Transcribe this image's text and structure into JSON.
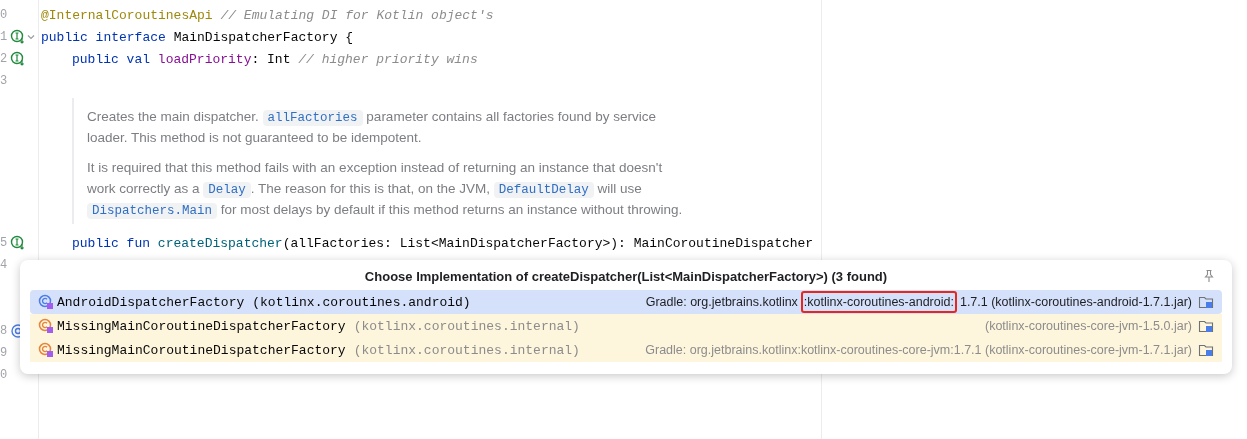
{
  "editor": {
    "lines": [
      {
        "kind": "code",
        "number": "0",
        "tokens": [
          {
            "kind": "annotation",
            "text": "@InternalCoroutinesApi"
          },
          {
            "kind": "comment",
            "text": " // Emulating DI for Kotlin object's"
          }
        ]
      },
      {
        "kind": "code",
        "number": "1",
        "gutter_icon": {
          "kind": "implemented"
        },
        "foldable": true,
        "tokens": [
          {
            "kind": "keyword",
            "text": "public interface"
          },
          {
            "kind": "plain",
            "text": " MainDispatcherFactory {"
          }
        ],
        "children": [
          {
            "kind": "code",
            "number": "2",
            "gutter_icon": {
              "kind": "implemented"
            },
            "tokens": [
              {
                "kind": "keyword",
                "text": "public val "
              },
              {
                "kind": "property",
                "text": "loadPriority"
              },
              {
                "kind": "plain",
                "text": ": Int "
              },
              {
                "kind": "comment",
                "text": "// higher priority wins"
              }
            ]
          },
          {
            "kind": "code",
            "number": "3"
          },
          {
            "kind": "doc",
            "paragraphs": [
              [
                {
                  "kind": "text",
                  "text": "Creates the main dispatcher. "
                },
                {
                  "kind": "code",
                  "text": "allFactories"
                },
                {
                  "kind": "text",
                  "text": " parameter contains all factories found by service loader. This method is not guaranteed to be idempotent."
                }
              ],
              [
                {
                  "kind": "text",
                  "text": "It is required that this method fails with an exception instead of returning an instance that doesn't work correctly as a "
                },
                {
                  "kind": "code",
                  "text": "Delay"
                },
                {
                  "kind": "text",
                  "text": ". The reason for this is that, on the JVM, "
                },
                {
                  "kind": "code",
                  "text": "DefaultDelay"
                },
                {
                  "kind": "text",
                  "text": " will use "
                },
                {
                  "kind": "code",
                  "text": "Dispatchers.Main"
                },
                {
                  "kind": "text",
                  "text": " for most delays by default if this method returns an instance without throwing."
                }
              ]
            ]
          },
          {
            "kind": "code",
            "number": "5",
            "gutter_icon": {
              "kind": "implemented"
            },
            "tokens": [
              {
                "kind": "keyword",
                "text": "public fun "
              },
              {
                "kind": "function",
                "text": "createDispatcher"
              },
              {
                "kind": "plain",
                "text": "(allFactories: List<MainDispatcherFactory>): MainCoroutineDispatcher"
              }
            ]
          }
        ]
      },
      {
        "kind": "code",
        "number": "4"
      },
      {
        "kind": "code"
      },
      {
        "kind": "code"
      },
      {
        "kind": "code",
        "number": "8",
        "gutter_icon": {
          "kind": "overrides"
        }
      },
      {
        "kind": "code",
        "number": "9"
      },
      {
        "kind": "code",
        "number": "0"
      }
    ]
  },
  "popup": {
    "title": "Choose Implementation of createDispatcher(List<MainDispatcherFactory>) (3 found)",
    "rows": [
      {
        "name": "AndroidDispatcherFactory",
        "package": "(kotlinx.coroutines.android)",
        "selected": true,
        "color": "#4a7de8",
        "location": [
          {
            "text": "Gradle: org.jetbrains.kotlinx",
            "boxed": false
          },
          {
            "text": ":kotlinx-coroutines-android:",
            "boxed": true
          },
          {
            "text": "1.7.1 (kotlinx-coroutines-android-1.7.1.jar)",
            "boxed": false
          }
        ]
      },
      {
        "name": "MissingMainCoroutineDispatcherFactory",
        "package": "(kotlinx.coroutines.internal)",
        "selected": false,
        "color": "#e8833a",
        "location": [
          {
            "text": "(kotlinx-coroutines-core-jvm-1.5.0.jar)",
            "boxed": false
          }
        ]
      },
      {
        "name": "MissingMainCoroutineDispatcherFactory",
        "package": "(kotlinx.coroutines.internal)",
        "selected": false,
        "color": "#e8833a",
        "location": [
          {
            "text": "Gradle: org.jetbrains.kotlinx:kotlinx-coroutines-core-jvm:1.7.1 (kotlinx-coroutines-core-jvm-1.7.1.jar)",
            "boxed": false
          }
        ]
      }
    ]
  }
}
